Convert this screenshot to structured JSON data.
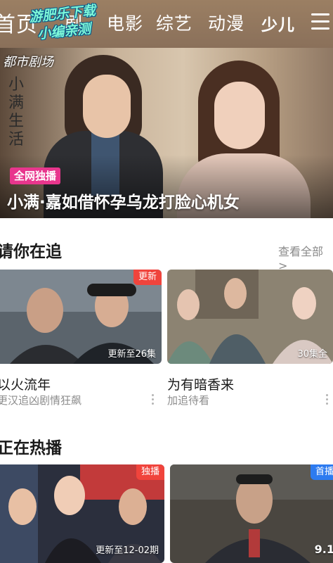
{
  "nav": {
    "tabs": [
      "首页",
      "剧",
      "电影",
      "综艺",
      "动漫",
      "少儿"
    ],
    "watermark": [
      "游肥乐下载",
      "小编亲测"
    ]
  },
  "banner": {
    "logo_badge": "都市剧场",
    "vertical_title": "小满生活",
    "tag": "全网独播",
    "caption": "小满·嘉如借怀孕乌龙打脸心机女"
  },
  "following": {
    "title": "请你在追",
    "see_all": "查看全部 >",
    "cards": [
      {
        "badge": "更新",
        "episode": "更新至26集",
        "title": "以火流年",
        "subtitle": "更汉追凶剧情狂飙"
      },
      {
        "badge": "",
        "episode": "30集全",
        "title": "为有暗香来",
        "subtitle": "加追待看"
      }
    ]
  },
  "hot": {
    "title": "正在热播",
    "cards": [
      {
        "badge": "独播",
        "episode": "更新至12-02期"
      },
      {
        "badge": "首播",
        "episode": "9.1"
      }
    ]
  },
  "colors": {
    "nav_bg": "#8a705a",
    "accent_pink": "#e8368d",
    "badge_red": "#f0443c",
    "badge_blue": "#2d7bf0"
  }
}
